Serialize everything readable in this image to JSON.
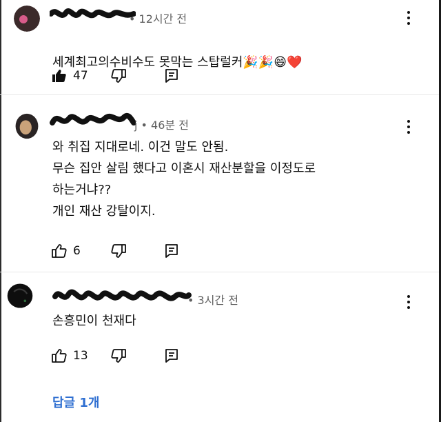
{
  "comments": [
    {
      "time": "• 12시간 전",
      "lines": "세계최고의수비수도 못막는 스탑럴커",
      "emoji": [
        "🎉",
        "🎉",
        "😄",
        "❤️"
      ],
      "likes": "47",
      "liked": true
    },
    {
      "time": "j • 46분 전",
      "lines": "와 취집 지대로네. 이건 말도 안됨.\n무슨 집안 살림 했다고 이혼시 재산분할을 이정도로\n하는거냐??\n개인 재산 강탈이지.",
      "likes": "6",
      "liked": false
    },
    {
      "time": "• 3시간 전",
      "lines": "손흥민이 천재다",
      "likes": "13",
      "liked": false
    }
  ],
  "replies_link": "답글 1개",
  "colors": {
    "link": "#2f6fd1",
    "meta": "#606060",
    "text": "#0f0f0f"
  },
  "icons": [
    "like-icon",
    "dislike-icon",
    "reply-icon",
    "more-options-icon"
  ]
}
